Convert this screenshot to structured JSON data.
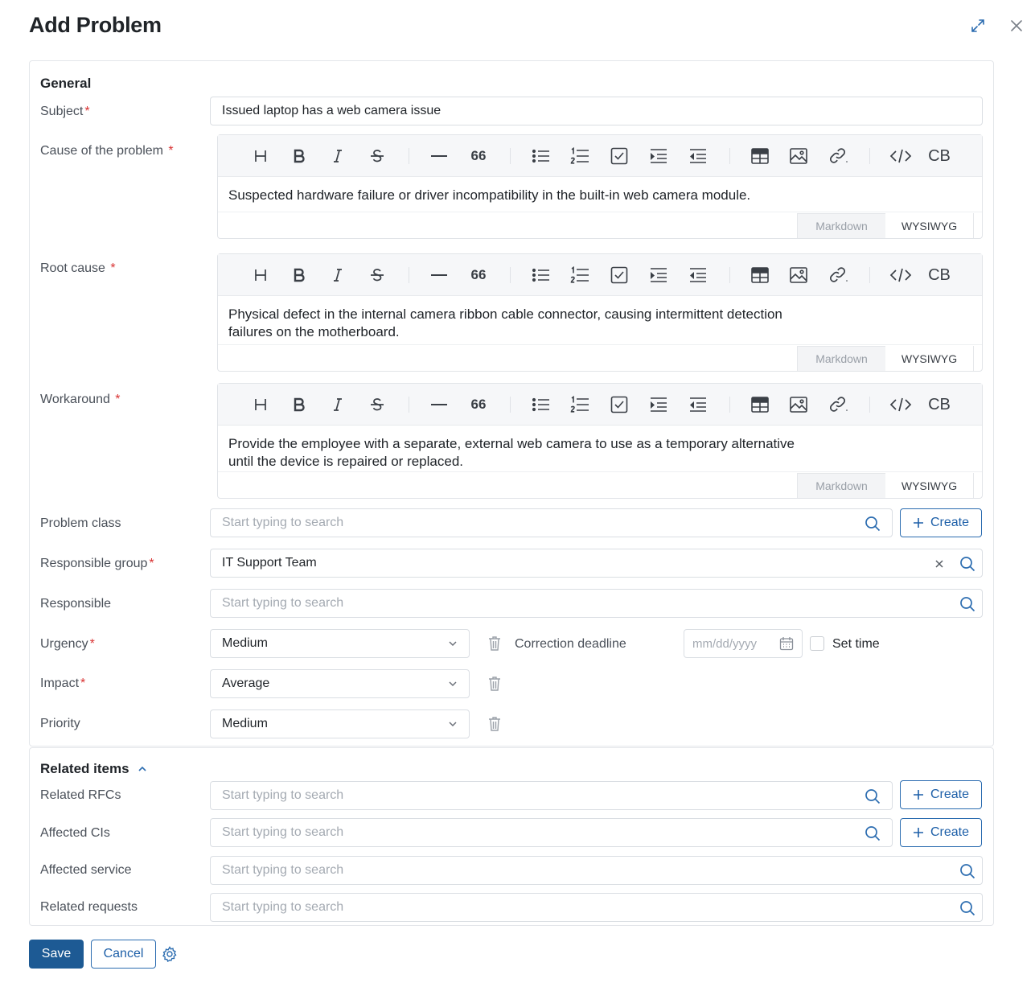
{
  "dialog": {
    "title": "Add Problem"
  },
  "general": {
    "section_title": "General",
    "subject": {
      "label": "Subject",
      "value": "Issued laptop has a web camera issue"
    },
    "cause": {
      "label": "Cause of the problem",
      "text": "Suspected hardware failure or driver incompatibility in the built-in web camera module."
    },
    "root_cause": {
      "label": "Root cause",
      "line1": "Physical defect in the internal camera ribbon cable connector, causing intermittent detection",
      "line2": "failures on the motherboard."
    },
    "workaround": {
      "label": "Workaround",
      "line1": "Provide the employee with a separate, external web camera to use as a temporary alternative",
      "line2": "until the device is repaired or replaced."
    },
    "editor_modes": {
      "markdown": "Markdown",
      "wysiwyg": "WYSIWYG"
    },
    "toolbar_cb": "CB",
    "problem_class": {
      "label": "Problem class",
      "placeholder": "Start typing to search"
    },
    "responsible_group": {
      "label": "Responsible group",
      "value": "IT Support Team"
    },
    "responsible": {
      "label": "Responsible",
      "placeholder": "Start typing to search"
    },
    "urgency": {
      "label": "Urgency",
      "value": "Medium"
    },
    "correction_deadline": {
      "label": "Correction deadline",
      "placeholder": "mm/dd/yyyy"
    },
    "set_time": {
      "label": "Set time",
      "checked": false
    },
    "impact": {
      "label": "Impact",
      "value": "Average"
    },
    "priority": {
      "label": "Priority",
      "value": "Medium"
    }
  },
  "related": {
    "section_title": "Related items",
    "rfcs": {
      "label": "Related RFCs",
      "placeholder": "Start typing to search"
    },
    "cis": {
      "label": "Affected CIs",
      "placeholder": "Start typing to search"
    },
    "service": {
      "label": "Affected service",
      "placeholder": "Start typing to search"
    },
    "requests": {
      "label": "Related requests",
      "placeholder": "Start typing to search"
    }
  },
  "buttons": {
    "create": "Create",
    "save": "Save",
    "cancel": "Cancel"
  },
  "colors": {
    "primary": "#1d5a94",
    "link": "#1d5fa8",
    "required": "#d93232"
  }
}
